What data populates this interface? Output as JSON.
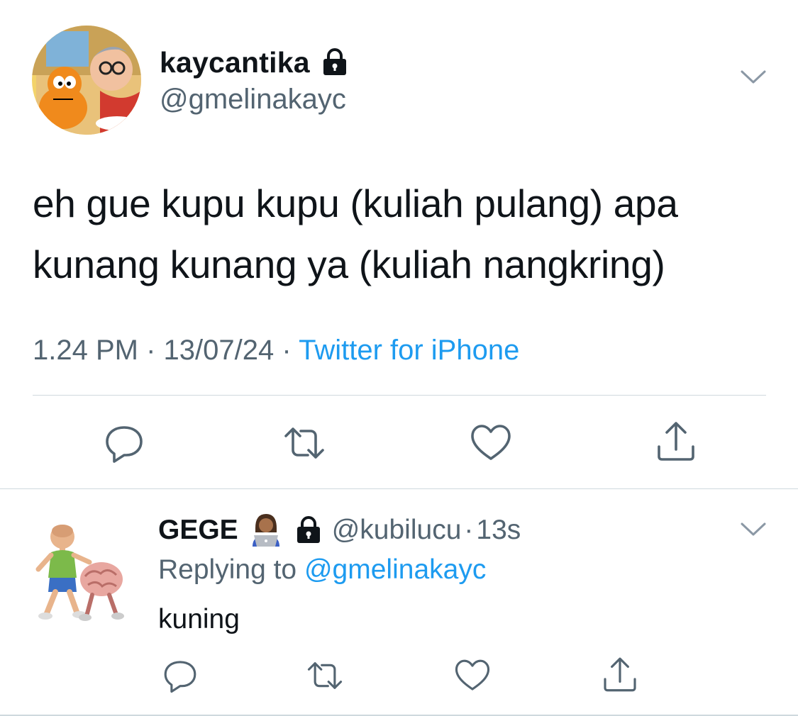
{
  "main_tweet": {
    "display_name": "kaycantika",
    "handle": "@gmelinakayc",
    "text_line_1": "eh gue kupu kupu (kuliah pulang) apa",
    "text_line_2": "kunang kunang ya (kuliah nangkring)",
    "time": "1.24 PM",
    "separator": "·",
    "date": "13/07/24",
    "source": "Twitter for iPhone",
    "avatar": "garfield-cartoon-avatar",
    "protected_icon": "lock-icon",
    "actions": [
      "reply-icon",
      "retweet-icon",
      "like-icon",
      "share-icon"
    ]
  },
  "reply_tweet": {
    "display_name": "GEGE",
    "emoji": "👩🏽‍💻",
    "handle": "@kubilucu",
    "separator": "·",
    "time": "13s",
    "replying_prefix": "Replying to",
    "replying_to": "@gmelinakayc",
    "text": "kuning",
    "avatar": "3d-man-with-brain-avatar",
    "protected_icon": "lock-icon",
    "actions": [
      "reply-icon",
      "retweet-icon",
      "like-icon",
      "share-icon"
    ]
  },
  "colors": {
    "text": "#0f1419",
    "secondary": "#536471",
    "link": "#1d9bf0",
    "divider": "#cfd9de"
  }
}
